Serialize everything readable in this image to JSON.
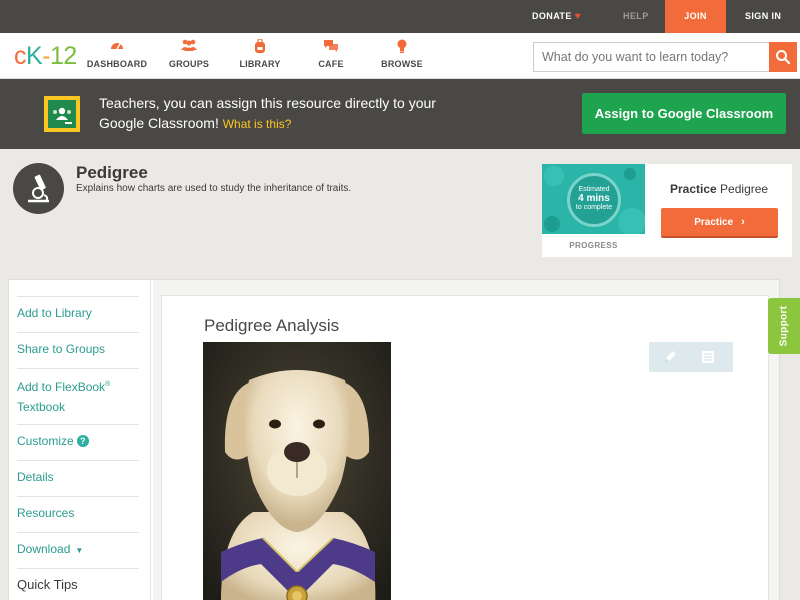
{
  "topbar": {
    "donate": "DONATE",
    "help": "HELP",
    "join": "JOIN",
    "signin": "SIGN IN"
  },
  "logo": {
    "c": "c",
    "k": "K",
    "dash": "-",
    "num": "12"
  },
  "nav": {
    "items": [
      {
        "label": "DASHBOARD",
        "icon": "dashboard-gauge-icon"
      },
      {
        "label": "GROUPS",
        "icon": "groups-people-icon"
      },
      {
        "label": "LIBRARY",
        "icon": "library-backpack-icon"
      },
      {
        "label": "CAFE",
        "icon": "cafe-chat-icon"
      },
      {
        "label": "BROWSE",
        "icon": "browse-lightbulb-icon"
      }
    ],
    "search_placeholder": "What do you want to learn today?"
  },
  "banner": {
    "text": "Teachers, you can assign this resource directly to your Google Classroom!",
    "what_link": "What is this?",
    "assign_button": "Assign to Google Classroom"
  },
  "concept": {
    "title": "Pedigree",
    "description": "Explains how charts are used to study the inheritance of traits."
  },
  "practice_card": {
    "estimated_line1": "Estimated",
    "estimated_line2": "4 mins",
    "estimated_line3": "to complete",
    "progress_label": "PROGRESS",
    "title_bold": "Practice",
    "title_rest": "Pedigree",
    "button": "Practice"
  },
  "sidebar": {
    "add_to_library": "Add to Library",
    "share_to_groups": "Share to Groups",
    "add_to_flexbook": "Add to FlexBook",
    "flexbook_reg": "®",
    "flexbook_textbook": "Textbook",
    "customize": "Customize",
    "customize_help": "?",
    "details": "Details",
    "resources": "Resources",
    "download": "Download",
    "download_arrow": "▼",
    "quick_tips": "Quick Tips"
  },
  "content": {
    "title": "Pedigree Analysis"
  },
  "support": "Support",
  "colors": {
    "dark": "#4a4845",
    "orange": "#f26b3a",
    "teal": "#2bb0a1",
    "green": "#1ea34f",
    "support_green": "#8cc63f",
    "yellow": "#f9c623"
  }
}
